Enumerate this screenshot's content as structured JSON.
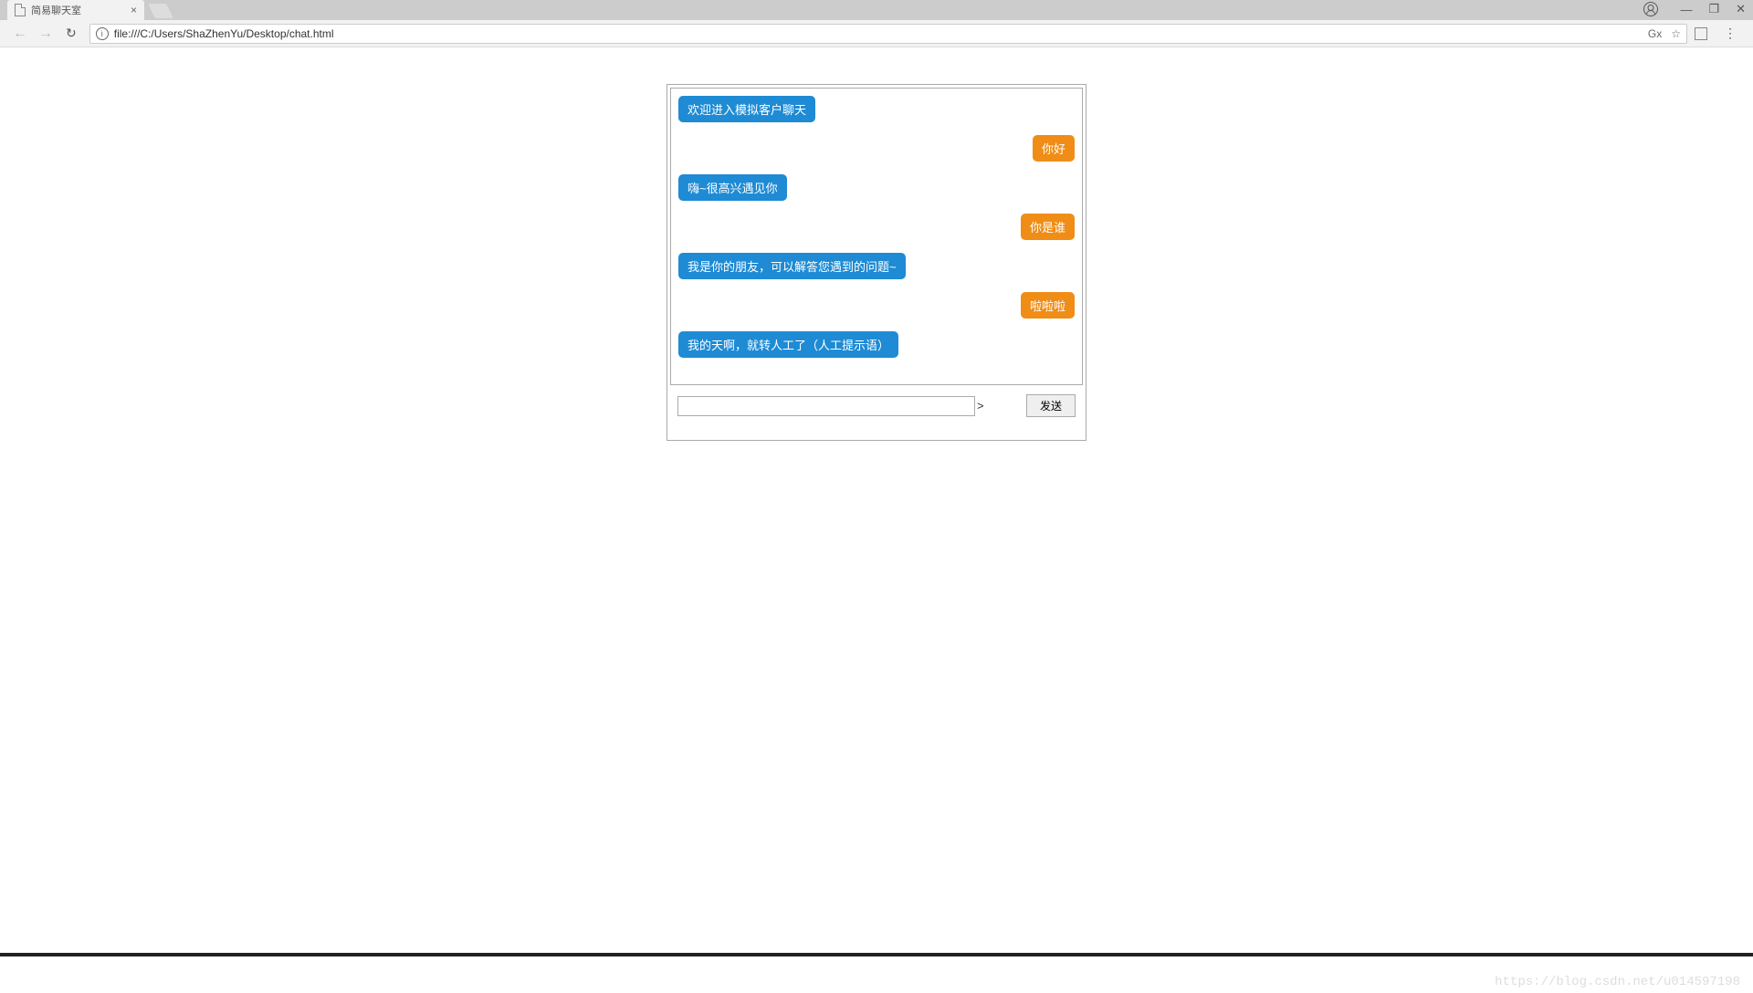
{
  "browser": {
    "tab_title": "简易聊天室",
    "tab_close": "×",
    "url": "file:///C:/Users/ShaZhenYu/Desktop/chat.html",
    "info_symbol": "i",
    "translate_label": "Gx",
    "star_label": "☆",
    "menu_label": "⋮",
    "minimize": "—",
    "maximize": "❐",
    "close": "✕",
    "back": "←",
    "forward": "→",
    "reload": "↻"
  },
  "chat": {
    "messages": [
      {
        "side": "left",
        "color": "blue",
        "text": "欢迎进入模拟客户聊天"
      },
      {
        "side": "right",
        "color": "orange",
        "text": "你好"
      },
      {
        "side": "left",
        "color": "blue",
        "text": "嗨~很高兴遇见你"
      },
      {
        "side": "right",
        "color": "orange",
        "text": "你是谁"
      },
      {
        "side": "left",
        "color": "blue",
        "text": "我是你的朋友，可以解答您遇到的问题~"
      },
      {
        "side": "right",
        "color": "orange",
        "text": "啦啦啦"
      },
      {
        "side": "left",
        "color": "blue",
        "text": "我的天啊，就转人工了（人工提示语）"
      }
    ],
    "caret_symbol": ">",
    "send_label": "发送",
    "input_value": ""
  },
  "watermark": "https://blog.csdn.net/u014597198"
}
